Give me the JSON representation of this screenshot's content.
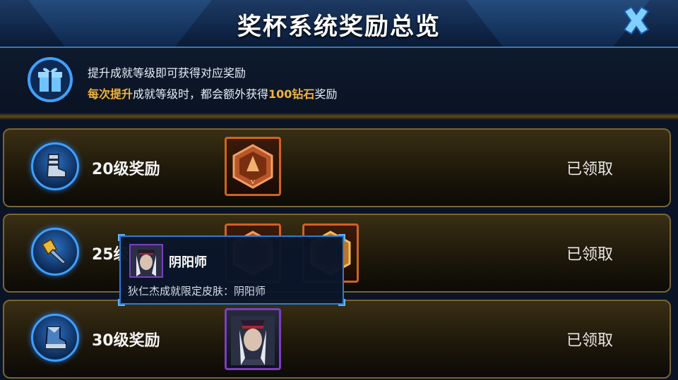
{
  "header": {
    "title": "奖杯系统奖励总览",
    "close_icon": "close-x-icon"
  },
  "info": {
    "icon": "gift-box-icon",
    "line1": "提升成就等级即可获得对应奖励",
    "line2_part1": "每次提升",
    "line2_part2": "成就等级时，都会额外获得",
    "line2_part3": "100钻石",
    "line2_part4": "奖励"
  },
  "rows": [
    {
      "label": "20级奖励",
      "status": "已领取",
      "icon": "boots-icon",
      "rewards": [
        "hexagon-badge-reward"
      ]
    },
    {
      "label": "25级",
      "status": "已领取",
      "icon": "scroll-blade-icon",
      "rewards": [
        "hexagon-badge-reward",
        "hexagon-badge-reward"
      ]
    },
    {
      "label": "30级奖励",
      "status": "已领取",
      "icon": "armored-boots-icon",
      "rewards": [
        "skin-portrait-reward"
      ]
    }
  ],
  "tooltip": {
    "name": "阴阳师",
    "description": "狄仁杰成就限定皮肤：阴阳师"
  },
  "colors": {
    "accent_gold": "#f0b338",
    "frame_blue": "#2f7bd0",
    "reward_border_orange": "#d1631f",
    "skin_border_purple": "#7b3fbe"
  }
}
